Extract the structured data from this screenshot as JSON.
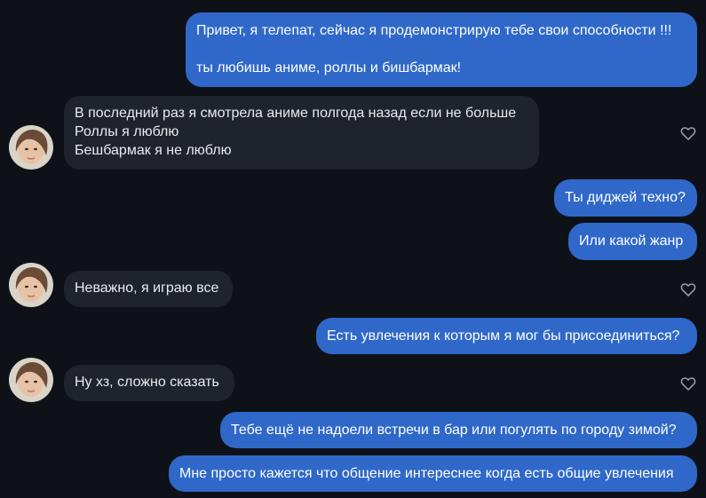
{
  "messages": [
    {
      "side": "out",
      "text": "Привет, я телепат, сейчас я продемонстрирую тебе свои способности !!!\n\nты любишь аниме, роллы и бишбармак!"
    },
    {
      "side": "in",
      "text": "В последний раз я смотрела аниме полгода назад если не больше\nРоллы я люблю\nБешбармак я не люблю"
    },
    {
      "side": "out",
      "text": "Ты диджей техно?"
    },
    {
      "side": "out",
      "text": "Или какой жанр"
    },
    {
      "side": "in",
      "text": "Неважно, я играю все"
    },
    {
      "side": "out",
      "text": "Есть увлечения к которым я мог бы присоединиться?"
    },
    {
      "side": "in",
      "text": "Ну хз, сложно сказать"
    },
    {
      "side": "out",
      "text": "Тебе ещё не надоели встречи в бар или погулять по городу зимой?"
    },
    {
      "side": "out",
      "text": "Мне просто кажется что общение интереснее когда есть общие увлечения"
    }
  ],
  "icons": {
    "avatar": "user-avatar",
    "like": "heart-outline-icon"
  },
  "colors": {
    "background": "#0e1117",
    "outgoing_bubble": "#2f68c9",
    "incoming_bubble": "#1f232b",
    "text": "#ffffff",
    "heart": "#9aa0a6"
  }
}
